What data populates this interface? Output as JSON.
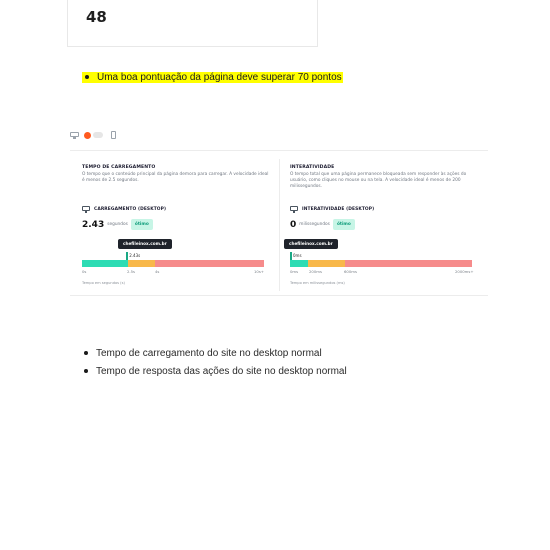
{
  "score": {
    "value": "48"
  },
  "highlight": {
    "text": "Uma boa pontuação da página deve superar 70 pontos",
    "bg_color": "#ffff00"
  },
  "device_toggle": {
    "desktop_icon": "monitor-icon",
    "mobile_icon": "phone-icon",
    "active_color": "#ff5a1f"
  },
  "metrics": {
    "load": {
      "title": "TEMPO DE CARREGAMENTO",
      "description": "O tempo que o conteúdo principal da página demora para carregar. A velocidade ideal é menos de 2.5 segundos.",
      "sub_label": "CARREGAMENTO (DESKTOP)",
      "value": "2.43",
      "unit": "segundos",
      "badge": "ótimo",
      "tooltip": "chefileinox.com.br",
      "pin_label": "2.43s",
      "ticks": [
        "0s",
        "2.5s",
        "4s",
        "10s+"
      ],
      "footnote": "Tempo em segundos (s)",
      "measured": 2.43,
      "thresholds": [
        2.5,
        4
      ],
      "max": 10
    },
    "interactivity": {
      "title": "INTERATIVIDADE",
      "description": "O tempo total que uma página permanece bloqueada sem responder às ações do usuário, como cliques no mouse ou na tela. A velocidade ideal é menos de 200 milissegundos.",
      "sub_label": "INTERATIVIDADE (DESKTOP)",
      "value": "0",
      "unit": "milissegundos",
      "badge": "ótimo",
      "tooltip": "chefileinox.com.br",
      "pin_label": "0ms",
      "ticks": [
        "0ms",
        "200ms",
        "600ms",
        "2000ms+"
      ],
      "footnote": "Tempo em milissegundos (ms)",
      "measured": 0,
      "thresholds": [
        200,
        600
      ],
      "max": 2000
    },
    "colors": {
      "good": "#2ddcb4",
      "medium": "#f8b84a",
      "bad": "#f68b8b",
      "badge_bg": "#c7f5e6",
      "badge_text": "#0e9c7a"
    }
  },
  "notes": [
    "Tempo de carregamento do site no desktop normal",
    "Tempo de resposta das ações do site no desktop normal"
  ]
}
